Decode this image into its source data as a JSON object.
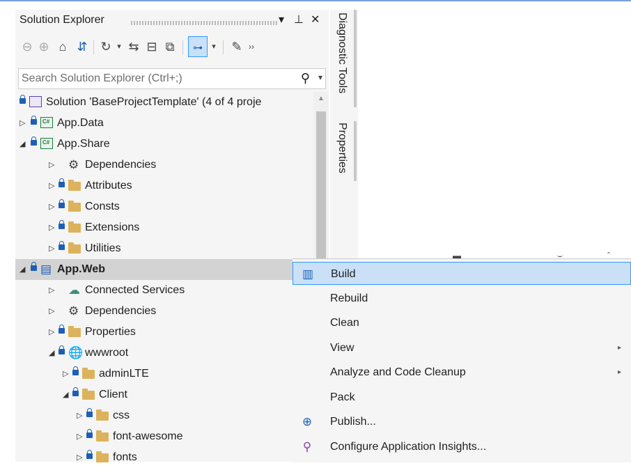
{
  "solution_explorer": {
    "title": "Solution Explorer",
    "search_placeholder": "Search Solution Explorer (Ctrl+;)",
    "title_buttons": [
      "▾",
      "⊥",
      "✕"
    ],
    "tree": [
      {
        "label": "Solution 'BaseProjectTemplate' (4 of 4 proje",
        "arrow": "",
        "icon": "solution-icon",
        "level": 0,
        "lock": true
      },
      {
        "label": "App.Data",
        "arrow": "▷",
        "icon": "csharp-project-icon",
        "level": 0,
        "lock": true
      },
      {
        "label": "App.Share",
        "arrow": "◢",
        "icon": "csharp-project-icon",
        "level": 0,
        "lock": true
      },
      {
        "label": "Dependencies",
        "arrow": "▷",
        "icon": "dependencies-icon",
        "level": 1,
        "lock": false
      },
      {
        "label": "Attributes",
        "arrow": "▷",
        "icon": "folder-icon",
        "level": 1,
        "lock": true
      },
      {
        "label": "Consts",
        "arrow": "▷",
        "icon": "folder-icon",
        "level": 1,
        "lock": true
      },
      {
        "label": "Extensions",
        "arrow": "▷",
        "icon": "folder-icon",
        "level": 1,
        "lock": true
      },
      {
        "label": "Utilities",
        "arrow": "▷",
        "icon": "folder-icon",
        "level": 1,
        "lock": true
      },
      {
        "label": "App.Web",
        "arrow": "◢",
        "icon": "web-project-icon",
        "level": 0,
        "lock": true,
        "selected": true
      },
      {
        "label": "Connected Services",
        "arrow": "▷",
        "icon": "connected-services-icon",
        "level": 1,
        "lock": false
      },
      {
        "label": "Dependencies",
        "arrow": "▷",
        "icon": "dependencies-icon",
        "level": 1,
        "lock": false
      },
      {
        "label": "Properties",
        "arrow": "▷",
        "icon": "properties-folder-icon",
        "level": 1,
        "lock": true
      },
      {
        "label": "wwwroot",
        "arrow": "◢",
        "icon": "globe-icon",
        "level": 1,
        "lock": true
      },
      {
        "label": "adminLTE",
        "arrow": "▷",
        "icon": "folder-icon",
        "level": 2,
        "lock": true
      },
      {
        "label": "Client",
        "arrow": "◢",
        "icon": "folder-icon",
        "level": 2,
        "lock": true
      },
      {
        "label": "css",
        "arrow": "▷",
        "icon": "folder-icon",
        "level": 3,
        "lock": true
      },
      {
        "label": "font-awesome",
        "arrow": "▷",
        "icon": "folder-icon",
        "level": 3,
        "lock": true
      },
      {
        "label": "fonts",
        "arrow": "▷",
        "icon": "folder-icon",
        "level": 3,
        "lock": true
      }
    ]
  },
  "side_tabs": [
    "Diagnostic Tools",
    "Properties"
  ],
  "context_menu": [
    {
      "label": "Build",
      "icon": "build-icon",
      "highlighted": true,
      "submenu": false
    },
    {
      "label": "Rebuild",
      "icon": "",
      "submenu": false
    },
    {
      "label": "Clean",
      "icon": "",
      "submenu": false
    },
    {
      "label": "View",
      "icon": "",
      "submenu": true
    },
    {
      "label": "Analyze and Code Cleanup",
      "icon": "",
      "submenu": true
    },
    {
      "label": "Pack",
      "icon": "",
      "submenu": false
    },
    {
      "label": "Publish...",
      "icon": "publish-icon",
      "submenu": false
    },
    {
      "label": "Configure Application Insights...",
      "icon": "app-insights-icon",
      "submenu": false
    }
  ],
  "colors": {
    "accent": "#3399ff",
    "highlight": "#c9e0f7",
    "selected_row": "#d3d3d3",
    "lock": "#1c5fb5",
    "folder": "#dcb35c"
  }
}
